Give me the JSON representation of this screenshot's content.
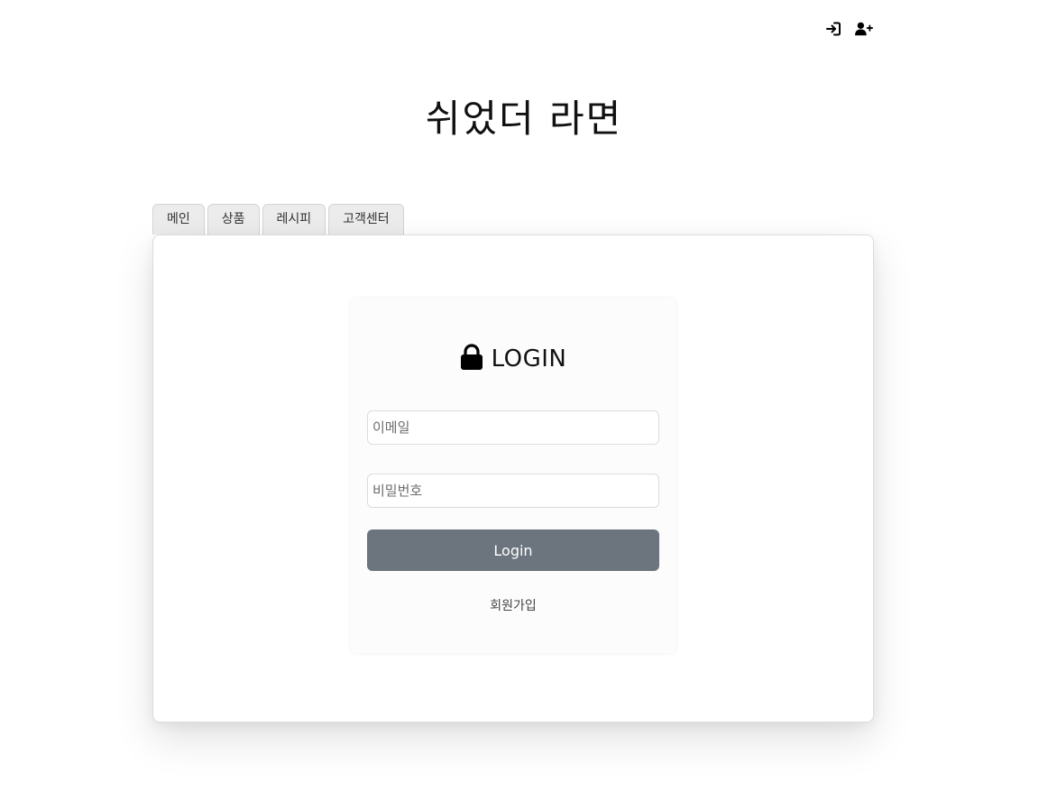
{
  "header": {
    "icons": [
      {
        "name": "login-icon"
      },
      {
        "name": "user-plus-icon"
      }
    ],
    "site_title": "쉬었더 라면"
  },
  "tabs": [
    {
      "label": "메인"
    },
    {
      "label": "상품"
    },
    {
      "label": "레시피"
    },
    {
      "label": "고객센터"
    }
  ],
  "login": {
    "icon": "lock-icon",
    "heading": "LOGIN",
    "email_placeholder": "이메일",
    "password_placeholder": "비밀번호",
    "submit_label": "Login",
    "signup_label": "회원가입"
  },
  "colors": {
    "button": "#6c757d",
    "tab_bg": "#ececec"
  }
}
